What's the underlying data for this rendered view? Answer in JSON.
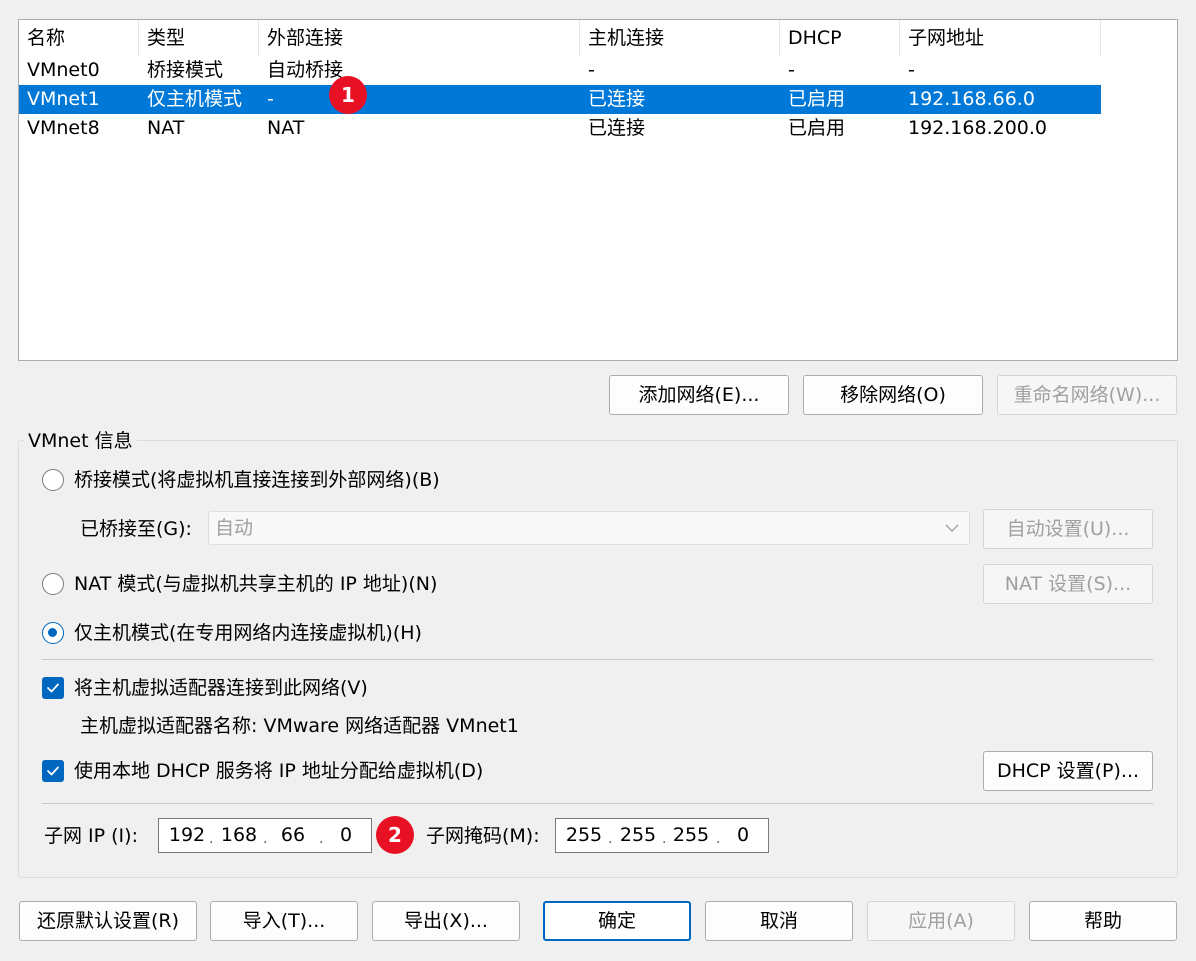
{
  "table": {
    "headers": [
      "名称",
      "类型",
      "外部连接",
      "主机连接",
      "DHCP",
      "子网地址"
    ],
    "rows": [
      [
        "VMnet0",
        "桥接模式",
        "自动桥接",
        "-",
        "-",
        "-"
      ],
      [
        "VMnet1",
        "仅主机模式",
        "-",
        "已连接",
        "已启用",
        "192.168.66.0"
      ],
      [
        "VMnet8",
        "NAT",
        "NAT",
        "已连接",
        "已启用",
        "192.168.200.0"
      ]
    ],
    "selected_row": 1
  },
  "network_buttons": {
    "add": "添加网络(E)...",
    "remove": "移除网络(O)",
    "rename": "重命名网络(W)..."
  },
  "vmnet_info": {
    "title": "VMnet 信息",
    "bridged": {
      "label": "桥接模式(将虚拟机直接连接到外部网络)(B)",
      "bridged_to_label": "已桥接至(G):",
      "bridged_to_value": "自动",
      "auto_settings": "自动设置(U)..."
    },
    "nat": {
      "label": "NAT 模式(与虚拟机共享主机的 IP 地址)(N)",
      "settings": "NAT 设置(S)..."
    },
    "hostonly": {
      "label": "仅主机模式(在专用网络内连接虚拟机)(H)"
    },
    "selected_mode": "hostonly",
    "connect_adapter": {
      "label": "将主机虚拟适配器连接到此网络(V)",
      "checked": true,
      "adapter_name_text": "主机虚拟适配器名称: VMware 网络适配器 VMnet1"
    },
    "dhcp": {
      "label": "使用本地 DHCP 服务将 IP 地址分配给虚拟机(D)",
      "checked": true,
      "settings": "DHCP 设置(P)..."
    },
    "subnet_ip": {
      "label": "子网 IP (I):",
      "octets": [
        "192",
        "168",
        "66",
        "0"
      ]
    },
    "subnet_mask": {
      "label": "子网掩码(M):",
      "octets": [
        "255",
        "255",
        "255",
        "0"
      ]
    }
  },
  "badges": [
    "1",
    "2"
  ],
  "bottom_buttons": {
    "restore": "还原默认设置(R)",
    "import": "导入(T)...",
    "export": "导出(X)...",
    "ok": "确定",
    "cancel": "取消",
    "apply": "应用(A)",
    "help": "帮助"
  },
  "colors": {
    "selection": "#0078d7",
    "accent": "#0067c0",
    "badge": "#e81123"
  },
  "icons": {
    "combo_arrow": "chevron-down-icon",
    "check_mark": "check-icon"
  }
}
